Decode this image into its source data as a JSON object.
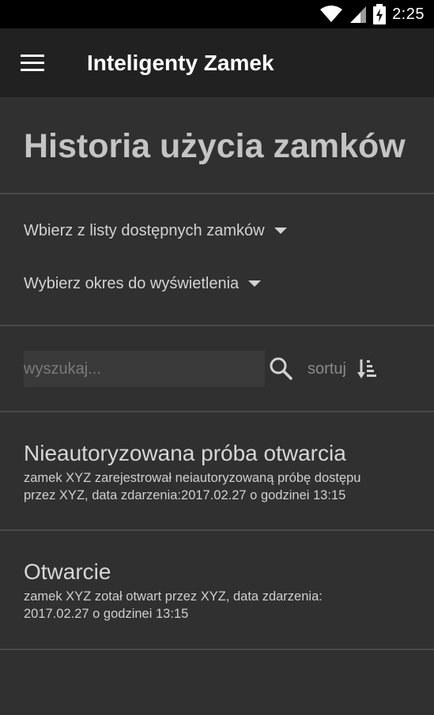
{
  "status_bar": {
    "time": "2:25",
    "icons": [
      "wifi-icon",
      "cell-signal-icon",
      "battery-charging-icon"
    ]
  },
  "app_bar": {
    "title": "Inteligenty Zamek",
    "menu_icon": "hamburger-menu-icon"
  },
  "page": {
    "title": "Historia użycia zamków"
  },
  "filters": {
    "lock_select": "Wbierz z listy dostępnych zamków",
    "period_select": "Wybierz okres do wyświetlenia"
  },
  "search": {
    "placeholder": "wyszukaj...",
    "value": "",
    "icon": "search-icon"
  },
  "sort": {
    "label": "sortuj",
    "icon": "sort-descending-icon"
  },
  "events": [
    {
      "title": "Nieautoryzowana próba otwarcia",
      "description_line1": "zamek XYZ zarejestrował neiautoryzowaną próbę dostępu",
      "description_line2": "przez XYZ, data zdarzenia:2017.02.27 o godzinei 13:15"
    },
    {
      "title": "Otwarcie",
      "description_line1": "zamek XYZ zotał otwart przez XYZ, data zdarzenia:",
      "description_line2": "2017.02.27 o godzinei 13:15"
    }
  ],
  "colors": {
    "background": "#303030",
    "app_bar": "#212121",
    "status_bar": "#000000",
    "text_primary": "#d6d6d6",
    "text_secondary": "#8a8a8a",
    "divider": "#4a4a4a"
  }
}
